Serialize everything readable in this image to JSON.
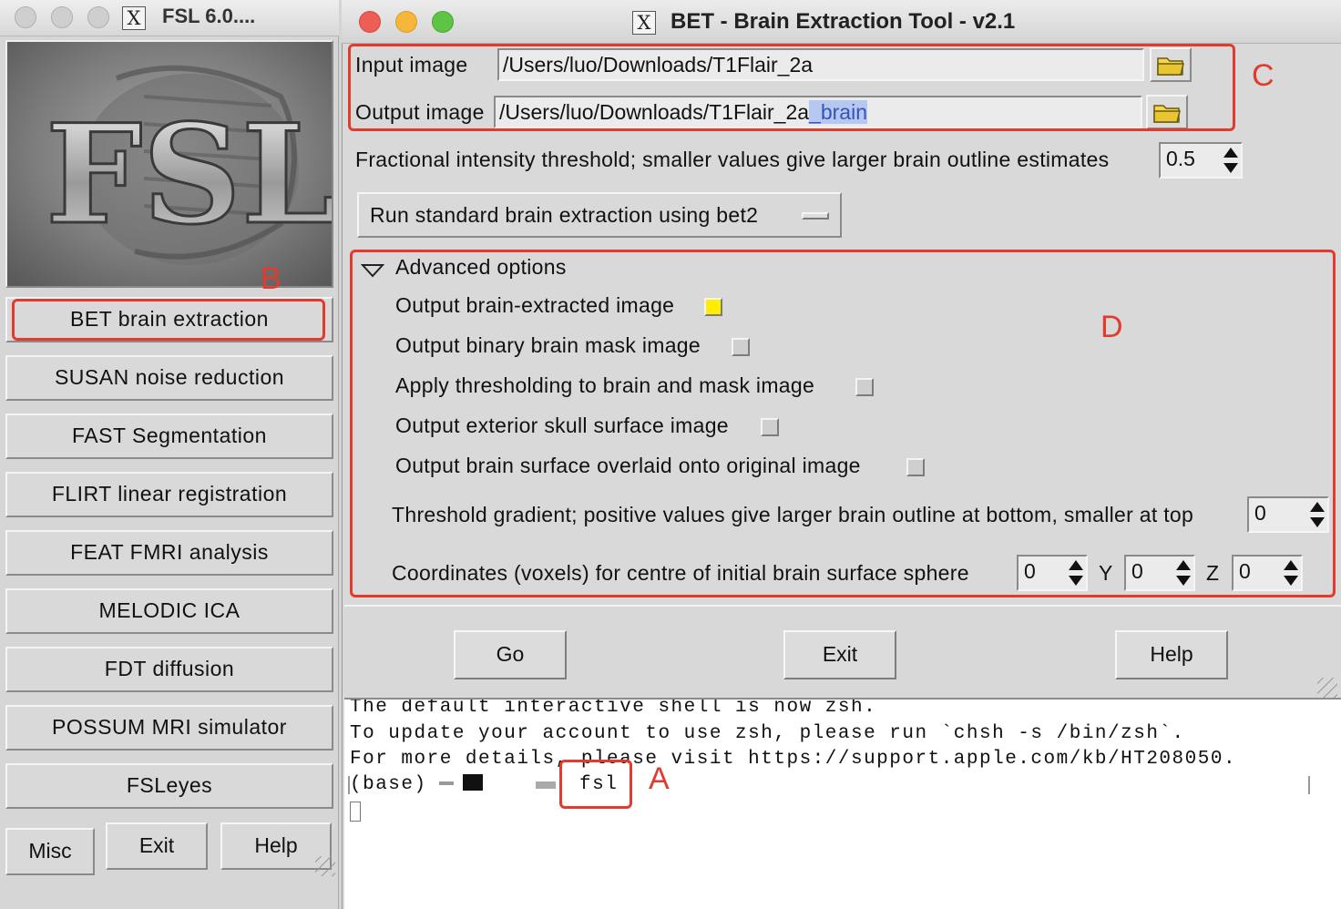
{
  "fsl_window": {
    "title": "FSL 6.0....",
    "buttons": [
      "BET brain extraction",
      "SUSAN noise reduction",
      "FAST Segmentation",
      "FLIRT linear registration",
      "FEAT FMRI analysis",
      "MELODIC ICA",
      "FDT diffusion",
      "POSSUM MRI simulator",
      "FSLeyes"
    ],
    "bottom_buttons": [
      "Misc",
      "Exit",
      "Help"
    ]
  },
  "bet_window": {
    "title": "BET - Brain Extraction Tool - v2.1",
    "input_label": "Input image",
    "input_value": "/Users/luo/Downloads/T1Flair_2a",
    "output_label": "Output image",
    "output_value": "/Users/luo/Downloads/T1Flair_2a",
    "output_selected_suffix": "_brain",
    "fit_label": "Fractional intensity threshold; smaller values give larger brain outline estimates",
    "fit_value": "0.5",
    "mode_dropdown": "Run standard brain extraction using bet2",
    "advanced_label": "Advanced options",
    "options": [
      {
        "label": "Output brain-extracted image",
        "checked": true
      },
      {
        "label": "Output binary brain mask image",
        "checked": false
      },
      {
        "label": "Apply thresholding to brain and mask image",
        "checked": false
      },
      {
        "label": "Output exterior skull surface image",
        "checked": false
      },
      {
        "label": "Output brain surface overlaid onto original image",
        "checked": false
      }
    ],
    "gradient_label": "Threshold gradient; positive values give larger brain outline at bottom, smaller at top",
    "gradient_value": "0",
    "coords_label": "Coordinates (voxels) for centre of initial brain surface sphere",
    "x_value": "0",
    "y_label": "Y",
    "y_value": "0",
    "z_label": "Z",
    "z_value": "0",
    "actions": [
      "Go",
      "Exit",
      "Help"
    ]
  },
  "terminal": {
    "lines": [
      "The default interactive shell is now zsh.",
      "To update your account to use zsh, please run `chsh -s /bin/zsh`.",
      "For more details, please visit https://support.apple.com/kb/HT208050."
    ],
    "prompt": "(base)",
    "command": "fsl"
  },
  "annotations": {
    "a": "A",
    "b": "B",
    "c": "C",
    "d": "D"
  },
  "colors": {
    "annotation_red": "#e23b2e",
    "checkbox_on": "#ffee00",
    "selection": "#b6c7f2"
  }
}
